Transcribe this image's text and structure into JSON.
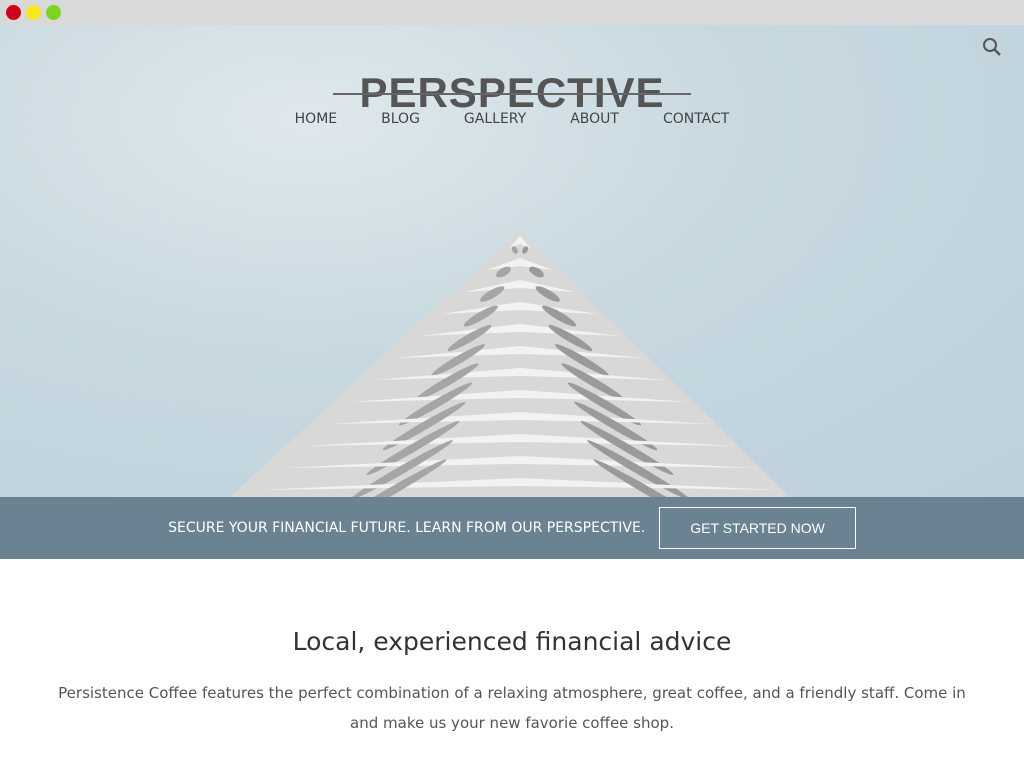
{
  "window": {
    "controls": [
      "close",
      "minimize",
      "maximize"
    ],
    "colors": {
      "close": "#d0011b",
      "minimize": "#f8e71c",
      "maximize": "#7ed321"
    }
  },
  "header": {
    "logo": "PERSPECTIVE",
    "nav": [
      "HOME",
      "BLOG",
      "GALLERY",
      "ABOUT",
      "CONTACT"
    ],
    "search_icon": "search-icon"
  },
  "banner": {
    "text": "SECURE YOUR FINANCIAL FUTURE. LEARN FROM OUR PERSPECTIVE.",
    "button": "GET STARTED NOW",
    "color": "#6b8292"
  },
  "content": {
    "heading": "Local, experienced financial advice",
    "body": "Persistence Coffee features the perfect combination of a relaxing atmosphere, great coffee, and a friendly staff. Come in and make us your new favorie coffee shop."
  }
}
